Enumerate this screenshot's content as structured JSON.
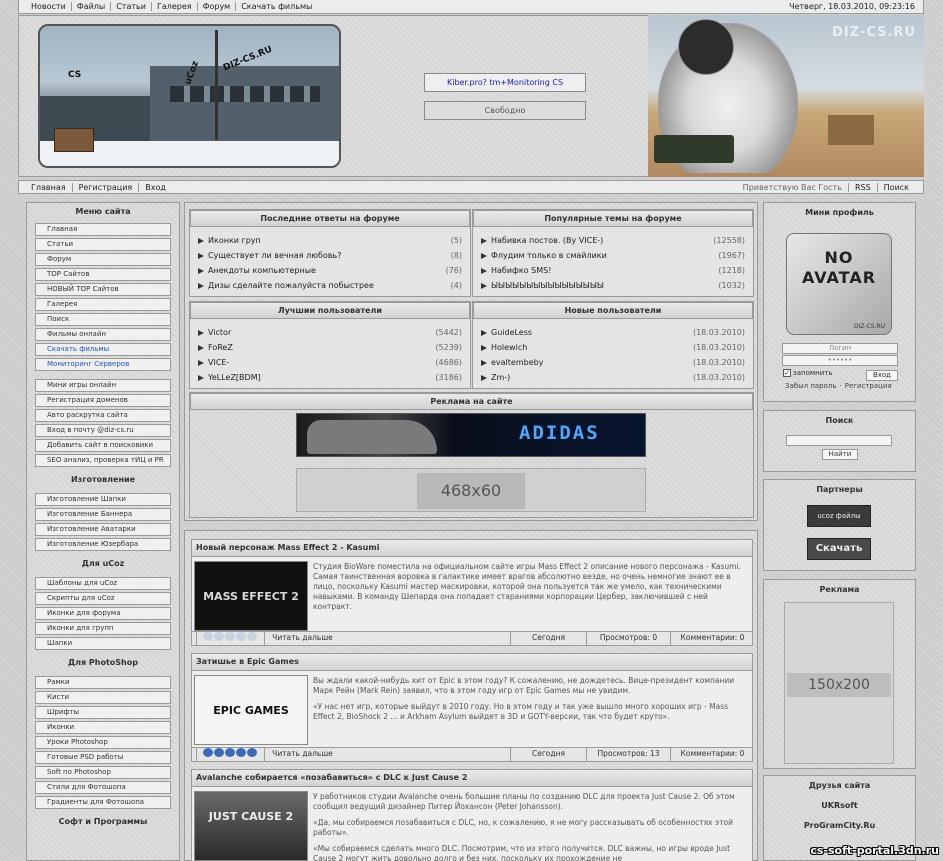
{
  "topbar": {
    "nav": [
      "Новости",
      "Файлы",
      "Статьи",
      "Галерея",
      "Форум",
      "Скачать фильмы"
    ],
    "datetime": "Четверг, 18.03.2010, 09:23:16"
  },
  "header": {
    "banner_labels": [
      "CS",
      "uCoz",
      "DIZ-CS.RU"
    ],
    "monitor_button": "Kiber.pro? tm+Monitoring CS",
    "free_button": "Свободно",
    "watermark": "DIZ-CS.RU"
  },
  "subnav": {
    "left": [
      "Главная",
      "Регистрация",
      "Вход"
    ],
    "right": [
      "Приветствую Вас Гость",
      "RSS",
      "Поиск"
    ]
  },
  "left": {
    "title": "Меню сайта",
    "menu": [
      "Главная",
      "Статьи",
      "Форум",
      "TOP Сайтов",
      "НОВЫЙ TOP Сайтов",
      "Галерея",
      "Поиск",
      "Фильмы онлайн",
      "Скачать фильмы",
      "Мониторинг Серверов"
    ],
    "menu2": [
      "Мини игры онлайн",
      "Регистрация доменов",
      "Авто раскрутка сайта",
      "Вход в почту @diz-cs.ru",
      "Добавить сайт в поисковики",
      "SEO анализ, проверка тИЦ и PR"
    ],
    "sec_make": "Изготовление",
    "make": [
      "Изготовление Шапки",
      "Изготовление Баннера",
      "Изготовление Аватарки",
      "Изготовление Юзербара"
    ],
    "sec_ucoz": "Для uCoz",
    "ucoz": [
      "Шаблоны для uCoz",
      "Скрипты для uCoz",
      "Иконки для форума",
      "Иконки для групп",
      "Шапки"
    ],
    "sec_ps": "Для PhotoShop",
    "ps": [
      "Рамки",
      "Кисти",
      "Шрифты",
      "Иконки",
      "Уроки Photoshop",
      "Готовые PSD работы",
      "Soft по Photoshop",
      "Стили для Фотошопа",
      "Градиенты для Фотошопа"
    ],
    "sec_soft": "Софт и Программы"
  },
  "center": {
    "forum_title": "Последние ответы на форуме",
    "forum": [
      {
        "t": "Иконки груп",
        "v": "(5)"
      },
      {
        "t": "Существует ли вечная любовь?",
        "v": "(8)"
      },
      {
        "t": "Анекдоты компьютерные",
        "v": "(76)"
      },
      {
        "t": "Дизы сделайте пожалуйста побыстрее",
        "v": "(4)"
      }
    ],
    "popular_title": "Популярные темы на форуме",
    "popular": [
      {
        "t": "Набивка постов. (By VICE-)",
        "v": "(12558)"
      },
      {
        "t": "Флудим только в смайлики",
        "v": "(1967)"
      },
      {
        "t": "Набифко SMS!",
        "v": "(1218)"
      },
      {
        "t": "ЫЫЫЫЫЫЫЫЫЫЫЫЫЫЫЫ",
        "v": "(1032)"
      }
    ],
    "best_title": "Лучшии пользователи",
    "best": [
      {
        "t": "Victor",
        "v": "(5442)"
      },
      {
        "t": "FoReZ",
        "v": "(5239)"
      },
      {
        "t": "VICE-",
        "v": "(4686)"
      },
      {
        "t": "YeLLeZ[BDM]",
        "v": "(3186)"
      }
    ],
    "new_title": "Новые пользователи",
    "newu": [
      {
        "t": "GuideLess",
        "v": "(18.03.2010)"
      },
      {
        "t": "Holewich",
        "v": "(18.03.2010)"
      },
      {
        "t": "evaltembeby",
        "v": "(18.03.2010)"
      },
      {
        "t": "Zm-)",
        "v": "(18.03.2010)"
      }
    ],
    "ad_title": "Реклама на сайте",
    "ad_text": "ADIDAS",
    "ad_468": "468x60"
  },
  "news": [
    {
      "title": "Новый персонаж Mass Effect 2 - Kasumi",
      "img": "MASS EFFECT 2",
      "text": "Студия BioWare поместила на официальном сайте игры Mass Effect 2 описание нового персонажа - Kasumi. Самая таинственная воровка в галактике имеет врагов абсолютно везде, но очень немногие знают ее в лицо, поскольку Kasumi мастер маскировки, которой она пользуется так же умело, как техническими навыками. В команду Шепарда она попадает стараниями корпорации Цербер, заключившей с ней контракт.",
      "more": "Читать дальше",
      "date": "Сегодня",
      "views": "Просмотров: 0",
      "comments": "Комментарии: 0",
      "rating": 0
    },
    {
      "title": "Затишье в Epic Games",
      "img": "EPIC GAMES",
      "text": "Вы ждали какой-нибудь хит от Epic в этом году? К сожалению, не дождетесь. Вице-президент компании Марк Рейн (Mark Rein) заявил, что в этом году игр от Epic Games мы не увидим.",
      "text2": "«У нас нет игр, которые выйдут в 2010 году. Но в этом году и так уже вышло много хороших игр - Mass Effect 2, BioShock 2 ... и Arkham Asylum выйдет в 3D и GOTY-версии, так что будет круто».",
      "more": "Читать дальше",
      "date": "Сегодня",
      "views": "Просмотров: 13",
      "comments": "Комментарии: 0",
      "rating": 5
    },
    {
      "title": "Avalanche собирается «позабавиться» с DLC к Just Cause 2",
      "img": "JUST CAUSE 2",
      "text": "У работников студии Avalanche очень большие планы по созданию DLC для проекта Just Cause 2. Об этом сообщил ведущий дизайнер Питер Йохансон (Peter Johansson).",
      "text2": "«Да, мы собираемся позабавиться с DLC, но, к сожалению, я не могу рассказывать об особенностях этой работы».",
      "text3": "«Мы собираемся сделать много DLC. Посмотрим, что из этого получится. DLC важны, но игры вроде Just Cause 2 могут жить довольно долго и без них, поскольку их прохождение не"
    }
  ],
  "right": {
    "profile_title": "Мини профиль",
    "noavatar": "NO AVATAR",
    "noavatar_site": "DIZ-CS.RU",
    "login_placeholder": "Логин",
    "password_placeholder": "••••••",
    "remember": "запомнить",
    "login_button": "Вход",
    "forgot": "Забыл пароль",
    "register": "Регистрация",
    "search_title": "Поиск",
    "search_button": "Найти",
    "partners_title": "Партнеры",
    "partner1": "ucoz файлы",
    "partner2": "Скачать",
    "ad_title": "Реклама",
    "ad_150": "150x200",
    "friends_title": "Друзья сайта",
    "friends": [
      "UKRsoft",
      "ProGramCity.Ru"
    ]
  },
  "watermark": "cs-soft-portal.3dn.ru"
}
